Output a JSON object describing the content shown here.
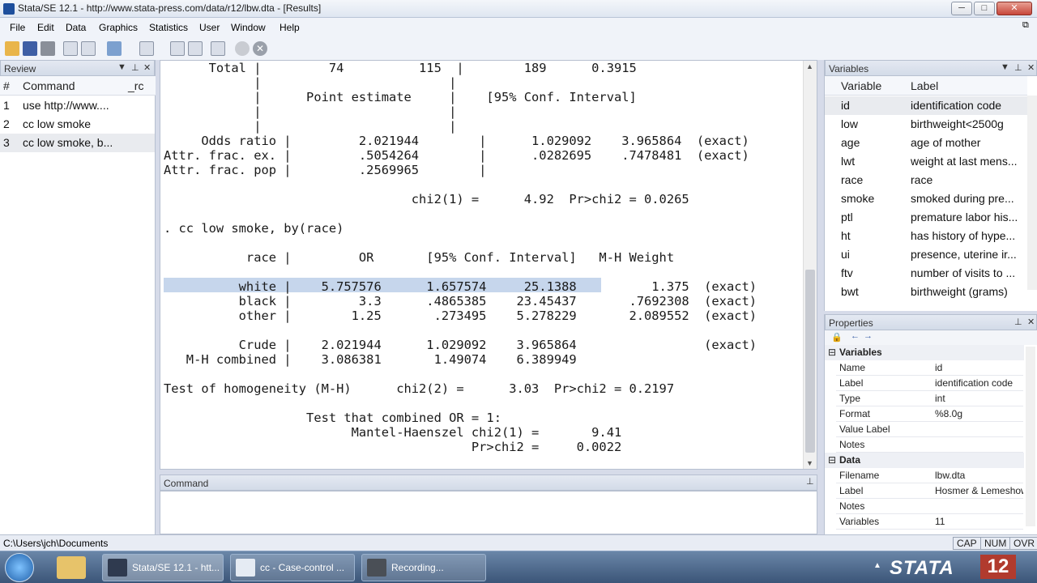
{
  "window": {
    "title": "Stata/SE 12.1 - http://www.stata-press.com/data/r12/lbw.dta - [Results]",
    "min": "─",
    "max": "□",
    "close": "✕"
  },
  "menu": [
    "File",
    "Edit",
    "Data",
    "Graphics",
    "Statistics",
    "User",
    "Window",
    "Help"
  ],
  "review": {
    "title": "Review",
    "col_num": "#",
    "col_cmd": "Command",
    "col_rc": "_rc",
    "rows": [
      {
        "n": "1",
        "cmd": "use http://www...."
      },
      {
        "n": "2",
        "cmd": "cc low smoke"
      },
      {
        "n": "3",
        "cmd": "cc low smoke, b..."
      }
    ]
  },
  "results": {
    "lines": [
      "      Total |         74          115  |        189      0.3915",
      "            |                         |",
      "            |      Point estimate     |    [95% Conf. Interval]",
      "            |                         |",
      "            |                         |",
      "     Odds ratio |         2.021944        |      1.029092    3.965864  (exact)",
      "Attr. frac. ex. |         .5054264        |      .0282695    .7478481  (exact)",
      "Attr. frac. pop |         .2569965        |",
      "",
      "                                 chi2(1) =      4.92  Pr>chi2 = 0.0265",
      "",
      ". cc low smoke, by(race)",
      "",
      "           race |         OR       [95% Conf. Interval]   M-H Weight",
      "",
      "          white |    5.757576      1.657574     25.1388          1.375  (exact)",
      "          black |         3.3      .4865385    23.45437       .7692308  (exact)",
      "          other |        1.25       .273495    5.278229       2.089552  (exact)",
      "",
      "          Crude |    2.021944      1.029092    3.965864                 (exact)",
      "   M-H combined |    3.086381       1.49074    6.389949",
      "",
      "Test of homogeneity (M-H)      chi2(2) =      3.03  Pr>chi2 = 0.2197",
      "",
      "                   Test that combined OR = 1:",
      "                         Mantel-Haenszel chi2(1) =       9.41",
      "                                         Pr>chi2 =     0.0022",
      "",
      "",
      "."
    ]
  },
  "command": {
    "title": "Command",
    "value": ""
  },
  "variables": {
    "title": "Variables",
    "col_var": "Variable",
    "col_label": "Label",
    "rows": [
      {
        "name": "id",
        "label": "identification code"
      },
      {
        "name": "low",
        "label": "birthweight<2500g"
      },
      {
        "name": "age",
        "label": "age of mother"
      },
      {
        "name": "lwt",
        "label": "weight at last mens..."
      },
      {
        "name": "race",
        "label": "race"
      },
      {
        "name": "smoke",
        "label": "smoked during pre..."
      },
      {
        "name": "ptl",
        "label": "premature labor his..."
      },
      {
        "name": "ht",
        "label": "has history of hype..."
      },
      {
        "name": "ui",
        "label": "presence, uterine ir..."
      },
      {
        "name": "ftv",
        "label": "number of visits to ..."
      },
      {
        "name": "bwt",
        "label": "birthweight (grams)"
      }
    ]
  },
  "properties": {
    "title": "Properties",
    "sec_vars": "Variables",
    "vars": [
      {
        "k": "Name",
        "v": "id"
      },
      {
        "k": "Label",
        "v": "identification code"
      },
      {
        "k": "Type",
        "v": "int"
      },
      {
        "k": "Format",
        "v": "%8.0g"
      },
      {
        "k": "Value Label",
        "v": ""
      },
      {
        "k": "Notes",
        "v": ""
      }
    ],
    "sec_data": "Data",
    "data": [
      {
        "k": "Filename",
        "v": "lbw.dta"
      },
      {
        "k": "Label",
        "v": "Hosmer & Lemeshow"
      },
      {
        "k": "Notes",
        "v": ""
      },
      {
        "k": "Variables",
        "v": "11"
      }
    ]
  },
  "status": {
    "path": "C:\\Users\\jch\\Documents",
    "caps": "CAP",
    "num": "NUM",
    "ovr": "OVR"
  },
  "taskbar": {
    "tasks": [
      "Stata/SE 12.1 - htt...",
      "cc - Case-control ...",
      "Recording..."
    ],
    "brand": "STATA",
    "version": "12"
  }
}
